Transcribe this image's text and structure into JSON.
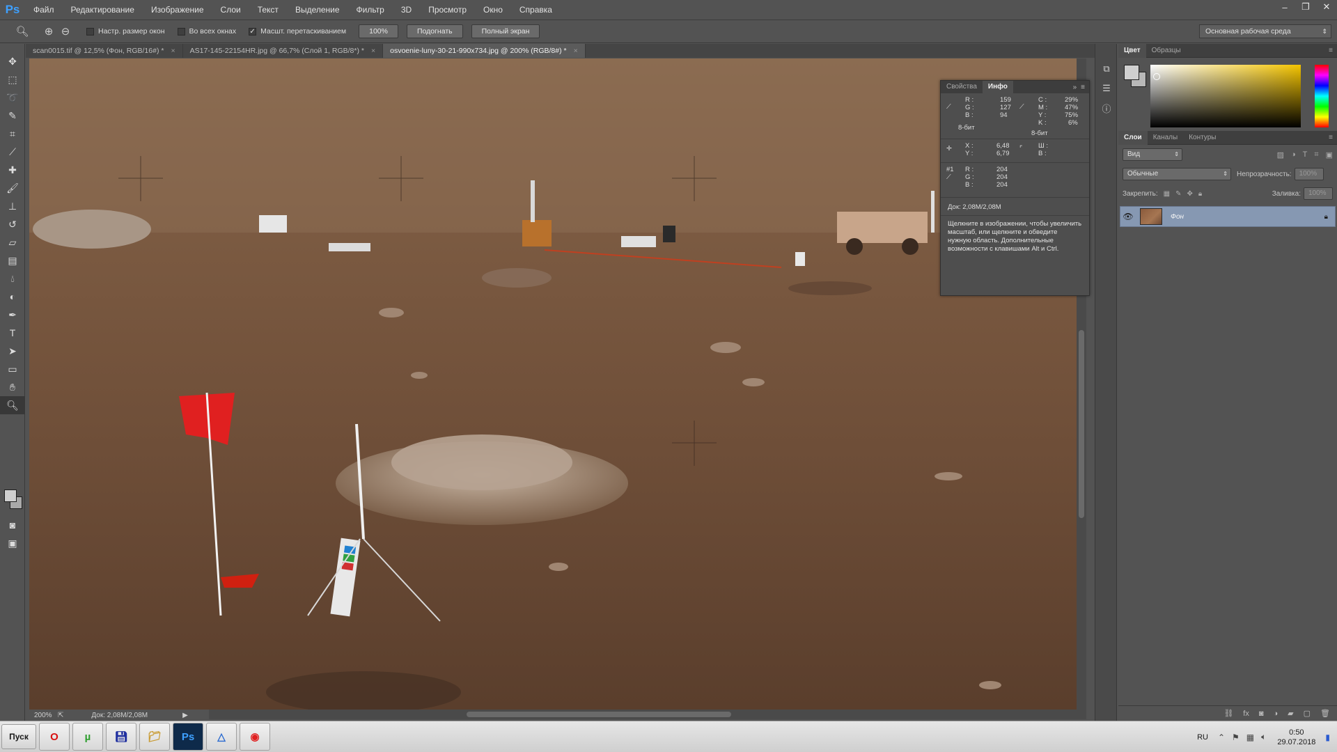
{
  "app": {
    "logo": "Ps"
  },
  "menu": [
    "Файл",
    "Редактирование",
    "Изображение",
    "Слои",
    "Текст",
    "Выделение",
    "Фильтр",
    "3D",
    "Просмотр",
    "Окно",
    "Справка"
  ],
  "options": {
    "resize_windows_label": "Настр. размер окон",
    "all_windows_label": "Во всех окнах",
    "scrubby_zoom_label": "Масшт. перетаскиванием",
    "zoom_100_label": "100%",
    "fit_label": "Подогнать",
    "fullscreen_label": "Полный экран",
    "workspace": "Основная рабочая среда"
  },
  "tabs": [
    {
      "label": "scan0015.tif @ 12,5% (Фон, RGB/16#) *"
    },
    {
      "label": "AS17-145-22154HR.jpg @ 66,7% (Слой 1, RGB/8*) *"
    },
    {
      "label": "osvoenie-luny-30-21-990x734.jpg @ 200% (RGB/8#) *"
    }
  ],
  "status": {
    "zoom": "200%",
    "doc": "Док: 2,08M/2,08M"
  },
  "info_panel": {
    "tab_properties": "Свойства",
    "tab_info": "Инфо",
    "rgb": {
      "r": "159",
      "g": "127",
      "b": "94",
      "bits": "8-бит"
    },
    "cmyk": {
      "c": "29%",
      "m": "47%",
      "y": "75%",
      "k": "6%",
      "bits": "8-бит"
    },
    "xy": {
      "x": "6,48",
      "y": "6,79"
    },
    "wh": {
      "w": "",
      "h": ""
    },
    "sampler1": {
      "label": "#1",
      "r": "204",
      "g": "204",
      "b": "204"
    },
    "doc_size": "Док: 2,08M/2,08M",
    "hint": "Щелкните в изображении, чтобы увеличить масштаб, или щелкните и обведите нужную область. Дополнительные возможности с клавишами Alt и Ctrl."
  },
  "color_panel": {
    "tab_color": "Цвет",
    "tab_swatches": "Образцы"
  },
  "layers_panel": {
    "tab_layers": "Слои",
    "tab_channels": "Каналы",
    "tab_paths": "Контуры",
    "filter": "Вид",
    "blend_mode": "Обычные",
    "opacity_label": "Непрозрачность:",
    "opacity_value": "100%",
    "lock_label": "Закрепить:",
    "fill_label": "Заливка:",
    "fill_value": "100%",
    "layer_name": "Фон"
  },
  "taskbar": {
    "start": "Пуск",
    "lang": "RU",
    "time": "0:50",
    "date": "29.07.2018"
  },
  "colors": {
    "accent": "#3ea0ff",
    "selected_layer": "#8698b2"
  }
}
